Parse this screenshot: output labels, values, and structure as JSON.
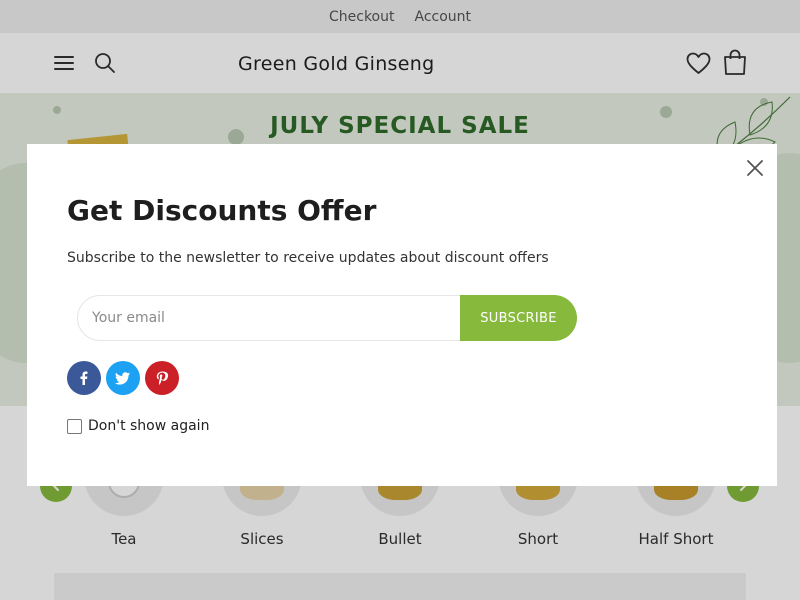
{
  "topbar": {
    "links": [
      "Checkout",
      "Account"
    ]
  },
  "header": {
    "brand": "Green Gold Ginseng",
    "icons": [
      "menu-icon",
      "search-icon",
      "heart-icon",
      "shopping-bag-icon"
    ]
  },
  "banner": {
    "title": "JULY SPECIAL SALE"
  },
  "categories": {
    "items": [
      {
        "label": "Tea"
      },
      {
        "label": "Slices"
      },
      {
        "label": "Bullet"
      },
      {
        "label": "Short"
      },
      {
        "label": "Half Short"
      }
    ],
    "icons": [
      "chevron-left-icon",
      "chevron-right-icon"
    ]
  },
  "modal": {
    "title": "Get Discounts Offer",
    "subtitle": "Subscribe to the newsletter to receive updates about discount offers",
    "email_placeholder": "Your email",
    "email_value": "",
    "subscribe_label": "SUBSCRIBE",
    "dont_show_label": "Don't show again",
    "dont_show_checked": false,
    "social": [
      {
        "name": "facebook-icon",
        "color": "#3b5998"
      },
      {
        "name": "twitter-icon",
        "color": "#1da1f2"
      },
      {
        "name": "pinterest-icon",
        "color": "#cb2027"
      }
    ]
  },
  "colors": {
    "accent": "#86b93c",
    "banner_bg": "#e7efe3",
    "banner_title": "#2f6b2a",
    "topbar_bg": "#efefef"
  }
}
